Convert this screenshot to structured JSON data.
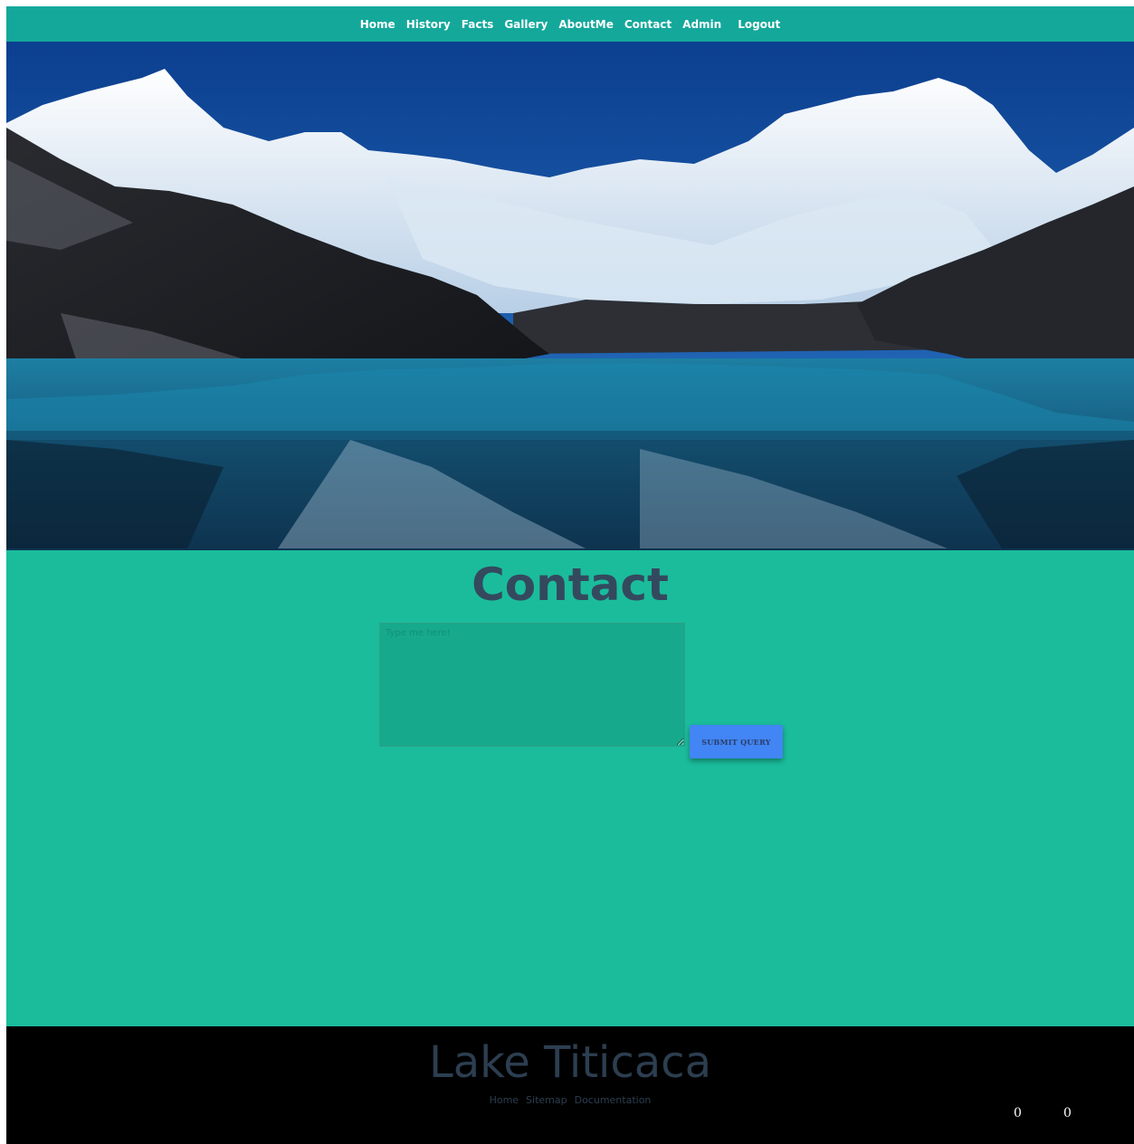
{
  "nav": {
    "items": [
      "Home",
      "History",
      "Facts",
      "Gallery",
      "AboutMe",
      "Contact",
      "Admin",
      "Logout"
    ]
  },
  "hero": {
    "alt": "mountain-lake-image"
  },
  "contact": {
    "title": "Contact",
    "message_placeholder": "Type me here!",
    "submit_label": "SUBMIT QUERY"
  },
  "footer": {
    "title": "Lake Titicaca",
    "links": [
      "Home",
      "Sitemap",
      "Documentation"
    ],
    "counter_left": "0",
    "counter_right": "0"
  },
  "colors": {
    "nav_bg": "#14a89b",
    "content_bg": "#1abc9c",
    "title_color": "#34495e",
    "button_bg": "#4285f4",
    "footer_bg": "#000000"
  }
}
